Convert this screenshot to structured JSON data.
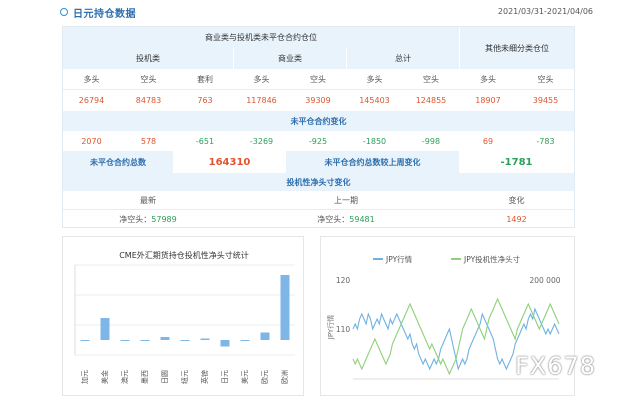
{
  "header": {
    "title": "日元持仓数据",
    "date_range": "2021/03/31-2021/04/06"
  },
  "table": {
    "group_title": "商业类与投机类未平仓合约仓位",
    "other_title": "其他未细分类仓位",
    "groups": {
      "spec": "投机类",
      "comm": "商业类",
      "total": "总计"
    },
    "cols": [
      "多头",
      "空头",
      "套利",
      "多头",
      "空头",
      "多头",
      "空头",
      "多头",
      "空头"
    ],
    "values": [
      "26794",
      "84783",
      "763",
      "117846",
      "39309",
      "145403",
      "124855",
      "18907",
      "39455"
    ],
    "change_title": "未平仓合约变化",
    "changes": [
      "2070",
      "578",
      "-651",
      "-3269",
      "-925",
      "-1850",
      "-998",
      "69",
      "-783"
    ],
    "oi_total_label": "未平仓合约总数",
    "oi_total": "164310",
    "oi_week_label": "未平仓合约总数较上周变化",
    "oi_week": "-1781",
    "net_title": "投机性净头寸变化",
    "net_cols": [
      "最新",
      "上一期",
      "变化"
    ],
    "net_latest_label": "净空头：",
    "net_latest": "57989",
    "net_prev_label": "净空头：",
    "net_prev": "59481",
    "net_change": "1492"
  },
  "chart_data": [
    {
      "type": "bar",
      "title": "CME外汇期货持仓投机性净头寸统计",
      "categories": [
        "加元",
        "美金",
        "澳元",
        "墨西",
        "日圆",
        "纽元",
        "英镑",
        "日元",
        "美元",
        "欧元",
        "欧洲"
      ],
      "values": [
        0,
        22000,
        0,
        0,
        3000,
        0,
        1500,
        -6500,
        0,
        7500,
        65000
      ],
      "ylim": [
        -15000,
        75000
      ],
      "bar_color": "#7fb6e8"
    },
    {
      "type": "line",
      "legend": [
        "JPY行情",
        "JPY投机性净头寸"
      ],
      "left_ticks": [
        "120",
        "110"
      ],
      "left_axis_label": "JPY行情",
      "right_ticks": [
        "200 000"
      ],
      "series": [
        {
          "name": "JPY行情",
          "color": "#6fb3e0",
          "values": [
            110,
            111,
            110,
            112,
            113,
            112,
            111,
            113,
            112,
            110,
            111,
            112,
            111,
            113,
            112,
            111,
            110,
            112,
            111,
            112,
            113,
            112,
            111,
            110,
            109,
            108,
            109,
            107,
            106,
            107,
            105,
            104,
            103,
            104,
            103,
            102,
            103,
            104,
            103,
            104,
            106,
            107,
            108,
            109,
            110,
            108,
            106,
            104,
            102,
            103,
            104,
            103,
            104,
            106,
            107,
            108,
            109,
            110,
            111,
            113,
            112,
            111,
            110,
            109,
            108,
            106,
            104,
            103,
            104,
            103,
            102,
            103,
            104,
            105,
            107,
            108,
            109,
            110,
            111,
            110,
            112,
            113,
            112,
            114,
            113,
            112,
            111,
            110,
            109,
            110,
            109,
            110,
            111,
            110,
            109
          ]
        },
        {
          "name": "JPY投机性净头寸",
          "color": "#8fd07a",
          "values": [
            104,
            103,
            104,
            103,
            102,
            103,
            104,
            105,
            106,
            107,
            108,
            107,
            106,
            105,
            104,
            103,
            104,
            105,
            107,
            108,
            109,
            110,
            111,
            112,
            113,
            114,
            115,
            114,
            113,
            112,
            111,
            110,
            109,
            108,
            107,
            106,
            107,
            106,
            105,
            104,
            103,
            104,
            103,
            102,
            101,
            102,
            103,
            104,
            106,
            108,
            110,
            111,
            112,
            113,
            114,
            113,
            112,
            111,
            110,
            109,
            108,
            110,
            112,
            113,
            114,
            115,
            116,
            115,
            114,
            113,
            112,
            111,
            110,
            109,
            108,
            110,
            111,
            112,
            113,
            114,
            115,
            114,
            113,
            112,
            111,
            110,
            111,
            112,
            113,
            114,
            115,
            114,
            113,
            112,
            111
          ]
        }
      ]
    }
  ]
}
